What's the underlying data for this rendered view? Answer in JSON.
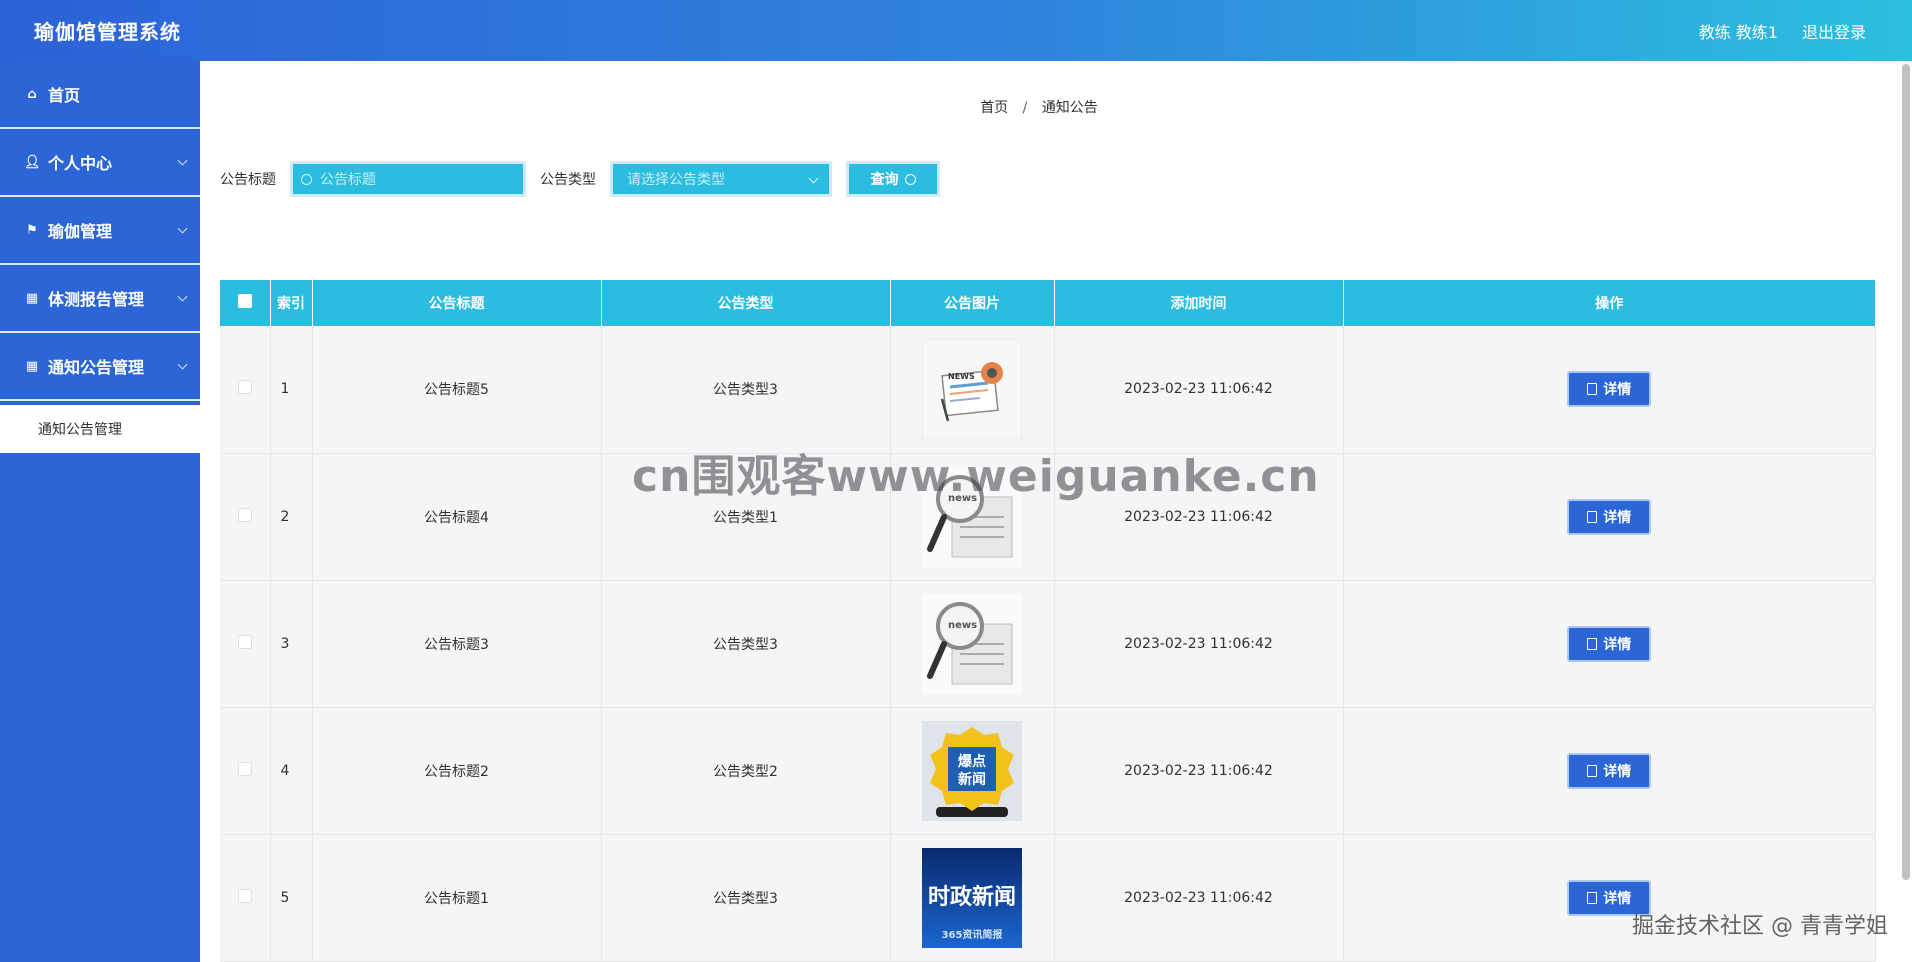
{
  "header": {
    "title": "瑜伽馆管理系统",
    "user": "教练 教练1",
    "logout": "退出登录"
  },
  "sidebar": {
    "items": [
      {
        "label": "首页",
        "icon": "home-icon",
        "has_children": false
      },
      {
        "label": "个人中心",
        "icon": "user-icon",
        "has_children": true
      },
      {
        "label": "瑜伽管理",
        "icon": "flag-icon",
        "has_children": true
      },
      {
        "label": "体测报告管理",
        "icon": "grid-icon",
        "has_children": true
      },
      {
        "label": "通知公告管理",
        "icon": "grid-icon",
        "has_children": true
      }
    ],
    "submenu": {
      "label": "通知公告管理"
    }
  },
  "breadcrumb": {
    "home": "首页",
    "separator": "/",
    "current": "通知公告"
  },
  "search": {
    "title_label": "公告标题",
    "title_placeholder": "公告标题",
    "type_label": "公告类型",
    "type_placeholder": "请选择公告类型",
    "query_label": "查询"
  },
  "table": {
    "headers": [
      "索引",
      "公告标题",
      "公告类型",
      "公告图片",
      "添加时间",
      "操作"
    ],
    "detail_label": "详情",
    "rows": [
      {
        "index": "1",
        "title": "公告标题5",
        "type": "公告类型3",
        "image": "news-paper-icon",
        "time": "2023-02-23 11:06:42"
      },
      {
        "index": "2",
        "title": "公告标题4",
        "type": "公告类型1",
        "image": "news-magnifier-image",
        "time": "2023-02-23 11:06:42"
      },
      {
        "index": "3",
        "title": "公告标题3",
        "type": "公告类型3",
        "image": "news-magnifier-image",
        "time": "2023-02-23 11:06:42"
      },
      {
        "index": "4",
        "title": "公告标题2",
        "type": "公告类型2",
        "image": "breaking-news-image",
        "image_text": "爆点新闻",
        "time": "2023-02-23 11:06:42"
      },
      {
        "index": "5",
        "title": "公告标题1",
        "type": "公告类型3",
        "image": "politics-news-image",
        "image_text": "时政新闻",
        "image_subtext": "365资讯简报",
        "time": "2023-02-23 11:06:42"
      }
    ]
  },
  "watermarks": {
    "center": "cn围观客www.weiguanke.cn",
    "footer": "掘金技术社区 @ 青青学姐"
  },
  "colors": {
    "header_start": "#2c62d8",
    "header_end": "#2cc0df",
    "sidebar": "#2c66d6",
    "accent": "#2bbde0"
  }
}
